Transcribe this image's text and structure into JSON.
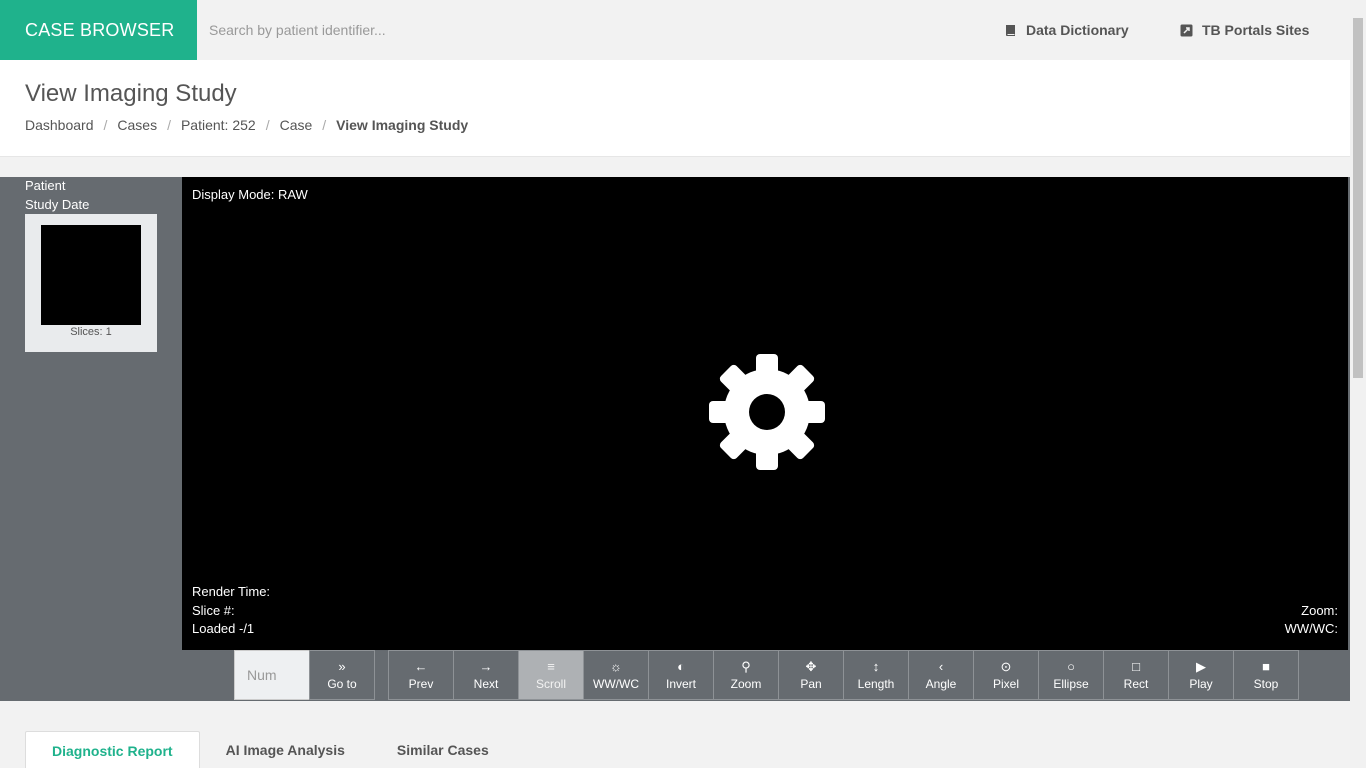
{
  "brand": "CASE BROWSER",
  "search": {
    "placeholder": "Search by patient identifier..."
  },
  "nav": {
    "data_dictionary": "Data Dictionary",
    "tb_portals": "TB Portals Sites"
  },
  "header": {
    "title": "View Imaging Study",
    "breadcrumbs": [
      "Dashboard",
      "Cases",
      "Patient: 252",
      "Case",
      "View Imaging Study"
    ]
  },
  "sidebar": {
    "patient_label": "Patient",
    "study_date_label": "Study Date",
    "thumbnail_caption": "Slices: 1"
  },
  "viewer": {
    "display_mode": "Display Mode: RAW",
    "render_time": "Render Time:",
    "slice_number": "Slice #:",
    "loaded": "Loaded -/1",
    "zoom": "Zoom:",
    "wwwc": "WW/WC:"
  },
  "toolbar": {
    "num_placeholder": "Num",
    "buttons": [
      {
        "label": "Go to",
        "icon": "double-chevron-right-icon",
        "glyph": "»"
      },
      {
        "label": "Prev",
        "icon": "arrow-left-icon",
        "glyph": "←"
      },
      {
        "label": "Next",
        "icon": "arrow-right-icon",
        "glyph": "→"
      },
      {
        "label": "Scroll",
        "icon": "menu-lines-icon",
        "glyph": "≡"
      },
      {
        "label": "WW/WC",
        "icon": "sun-icon",
        "glyph": "☼"
      },
      {
        "label": "Invert",
        "icon": "half-circle-icon",
        "glyph": "◐"
      },
      {
        "label": "Zoom",
        "icon": "magnifier-icon",
        "glyph": "⚲"
      },
      {
        "label": "Pan",
        "icon": "move-arrows-icon",
        "glyph": "✥"
      },
      {
        "label": "Length",
        "icon": "vertical-arrow-icon",
        "glyph": "↕"
      },
      {
        "label": "Angle",
        "icon": "angle-icon",
        "glyph": "‹"
      },
      {
        "label": "Pixel",
        "icon": "dot-circle-icon",
        "glyph": "⊙"
      },
      {
        "label": "Ellipse",
        "icon": "circle-icon",
        "glyph": "○"
      },
      {
        "label": "Rect",
        "icon": "square-icon",
        "glyph": "□"
      },
      {
        "label": "Play",
        "icon": "play-icon",
        "glyph": "▶"
      },
      {
        "label": "Stop",
        "icon": "stop-icon",
        "glyph": "■"
      }
    ],
    "active": "Scroll"
  },
  "tabs": [
    "Diagnostic Report",
    "AI Image Analysis",
    "Similar Cases"
  ],
  "active_tab": "Diagnostic Report",
  "colors": {
    "brand": "#1fb28c",
    "panel": "#666b70",
    "canvas": "#000000",
    "active_tool": "#aeb1b4"
  }
}
